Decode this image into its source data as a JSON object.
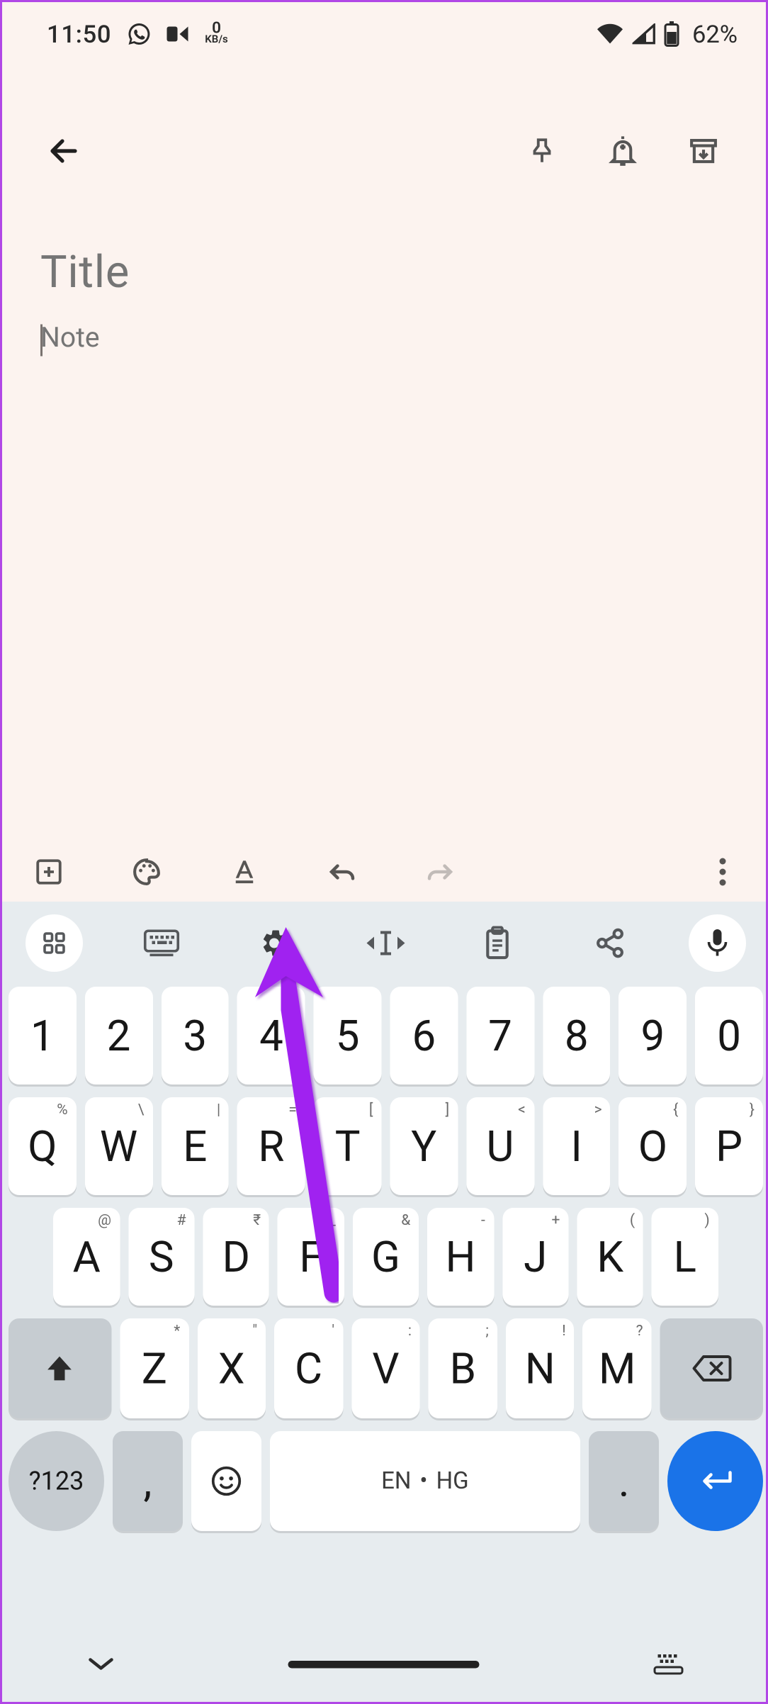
{
  "status": {
    "time": "11:50",
    "kbps_num": "0",
    "kbps_unit": "KB/s",
    "battery": "62%"
  },
  "note": {
    "title_placeholder": "Title",
    "body_placeholder": "Note"
  },
  "keyboard": {
    "row_num": [
      "1",
      "2",
      "3",
      "4",
      "5",
      "6",
      "7",
      "8",
      "9",
      "0"
    ],
    "row_q": [
      {
        "k": "Q",
        "s": "%"
      },
      {
        "k": "W",
        "s": "\\"
      },
      {
        "k": "E",
        "s": "|"
      },
      {
        "k": "R",
        "s": "="
      },
      {
        "k": "T",
        "s": "["
      },
      {
        "k": "Y",
        "s": "]"
      },
      {
        "k": "U",
        "s": "<"
      },
      {
        "k": "I",
        "s": ">"
      },
      {
        "k": "O",
        "s": "{"
      },
      {
        "k": "P",
        "s": "}"
      }
    ],
    "row_a": [
      {
        "k": "A",
        "s": "@"
      },
      {
        "k": "S",
        "s": "#"
      },
      {
        "k": "D",
        "s": "₹"
      },
      {
        "k": "F",
        "s": "_"
      },
      {
        "k": "G",
        "s": "&"
      },
      {
        "k": "H",
        "s": "-"
      },
      {
        "k": "J",
        "s": "+"
      },
      {
        "k": "K",
        "s": "("
      },
      {
        "k": "L",
        "s": ")"
      }
    ],
    "row_z": [
      {
        "k": "Z",
        "s": "*"
      },
      {
        "k": "X",
        "s": "\""
      },
      {
        "k": "C",
        "s": "'"
      },
      {
        "k": "V",
        "s": ":"
      },
      {
        "k": "B",
        "s": ";"
      },
      {
        "k": "N",
        "s": "!"
      },
      {
        "k": "M",
        "s": "?"
      }
    ],
    "mode_key": "?123",
    "comma": ",",
    "period": ".",
    "space_lang1": "EN",
    "space_lang2": "HG"
  }
}
